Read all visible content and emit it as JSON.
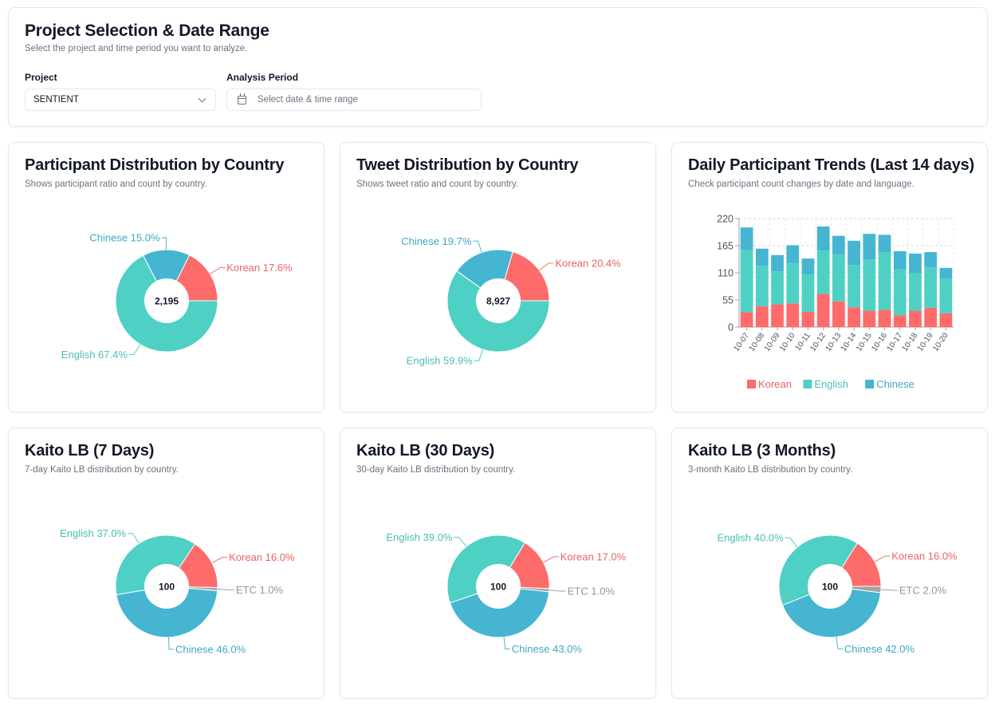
{
  "filters": {
    "title": "Project Selection & Date Range",
    "description": "Select the project and time period you want to analyze.",
    "project_label": "Project",
    "project_value": "SENTIENT",
    "period_label": "Analysis Period",
    "period_placeholder": "Select date & time range"
  },
  "colors": {
    "Korean": "#fd6b6b",
    "English": "#4fd0c4",
    "Chinese": "#45b5d1",
    "ETC": "#a3a3a3"
  },
  "cards": {
    "participant": {
      "title": "Participant Distribution by Country",
      "description": "Shows participant ratio and count by country."
    },
    "tweet": {
      "title": "Tweet Distribution by Country",
      "description": "Shows tweet ratio and count by country."
    },
    "trends": {
      "title": "Daily Participant Trends (Last 14 days)",
      "description": "Check participant count changes by date and language."
    },
    "kaito7": {
      "title": "Kaito LB (7 Days)",
      "description": "7-day Kaito LB distribution by country."
    },
    "kaito30": {
      "title": "Kaito LB (30 Days)",
      "description": "30-day Kaito LB distribution by country."
    },
    "kaito3m": {
      "title": "Kaito LB (3 Months)",
      "description": "3-month Kaito LB distribution by country."
    }
  },
  "chart_data": [
    {
      "id": "participant",
      "type": "pie",
      "center_label": "2,195",
      "slices": [
        {
          "name": "English",
          "label": "English 67.4%",
          "value": 67.4
        },
        {
          "name": "Chinese",
          "label": "Chinese 15.0%",
          "value": 15.0
        },
        {
          "name": "Korean",
          "label": "Korean 17.6%",
          "value": 17.6
        }
      ]
    },
    {
      "id": "tweet",
      "type": "pie",
      "center_label": "8,927",
      "slices": [
        {
          "name": "English",
          "label": "English 59.9%",
          "value": 59.9
        },
        {
          "name": "Chinese",
          "label": "Chinese 19.7%",
          "value": 19.7
        },
        {
          "name": "Korean",
          "label": "Korean 20.4%",
          "value": 20.4
        }
      ]
    },
    {
      "id": "trends",
      "type": "bar",
      "stacked": true,
      "categories": [
        "10-07",
        "10-08",
        "10-09",
        "10-10",
        "10-11",
        "10-12",
        "10-13",
        "10-14",
        "10-15",
        "10-16",
        "10-17",
        "10-18",
        "10-19",
        "10-20"
      ],
      "series": [
        {
          "name": "Korean",
          "values": [
            30,
            42,
            46,
            48,
            31,
            67,
            52,
            40,
            33,
            35,
            24,
            33,
            39,
            28
          ]
        },
        {
          "name": "English",
          "values": [
            127,
            82,
            67,
            82,
            76,
            88,
            96,
            86,
            104,
            117,
            93,
            77,
            82,
            70
          ]
        },
        {
          "name": "Chinese",
          "values": [
            45,
            35,
            33,
            36,
            32,
            49,
            37,
            49,
            52,
            35,
            37,
            39,
            31,
            22
          ]
        }
      ],
      "yticks": [
        "0",
        "55",
        "110",
        "165",
        "220"
      ],
      "ylim": [
        0,
        220
      ],
      "grid": true,
      "legend": "bottom"
    },
    {
      "id": "kaito7",
      "type": "pie",
      "center_label": "100",
      "slices": [
        {
          "name": "Korean",
          "label": "Korean 16.0%",
          "value": 16.0
        },
        {
          "name": "ETC",
          "label": "ETC 1.0%",
          "value": 1.0
        },
        {
          "name": "Chinese",
          "label": "Chinese 46.0%",
          "value": 46.0
        },
        {
          "name": "English",
          "label": "English 37.0%",
          "value": 37.0
        }
      ]
    },
    {
      "id": "kaito30",
      "type": "pie",
      "center_label": "100",
      "slices": [
        {
          "name": "Korean",
          "label": "Korean 17.0%",
          "value": 17.0
        },
        {
          "name": "ETC",
          "label": "ETC 1.0%",
          "value": 1.0
        },
        {
          "name": "Chinese",
          "label": "Chinese 43.0%",
          "value": 43.0
        },
        {
          "name": "English",
          "label": "English 39.0%",
          "value": 39.0
        }
      ]
    },
    {
      "id": "kaito3m",
      "type": "pie",
      "center_label": "100",
      "slices": [
        {
          "name": "Korean",
          "label": "Korean 16.0%",
          "value": 16.0
        },
        {
          "name": "ETC",
          "label": "ETC 2.0%",
          "value": 2.0
        },
        {
          "name": "Chinese",
          "label": "Chinese 42.0%",
          "value": 42.0
        },
        {
          "name": "English",
          "label": "English 40.0%",
          "value": 40.0
        }
      ]
    }
  ]
}
